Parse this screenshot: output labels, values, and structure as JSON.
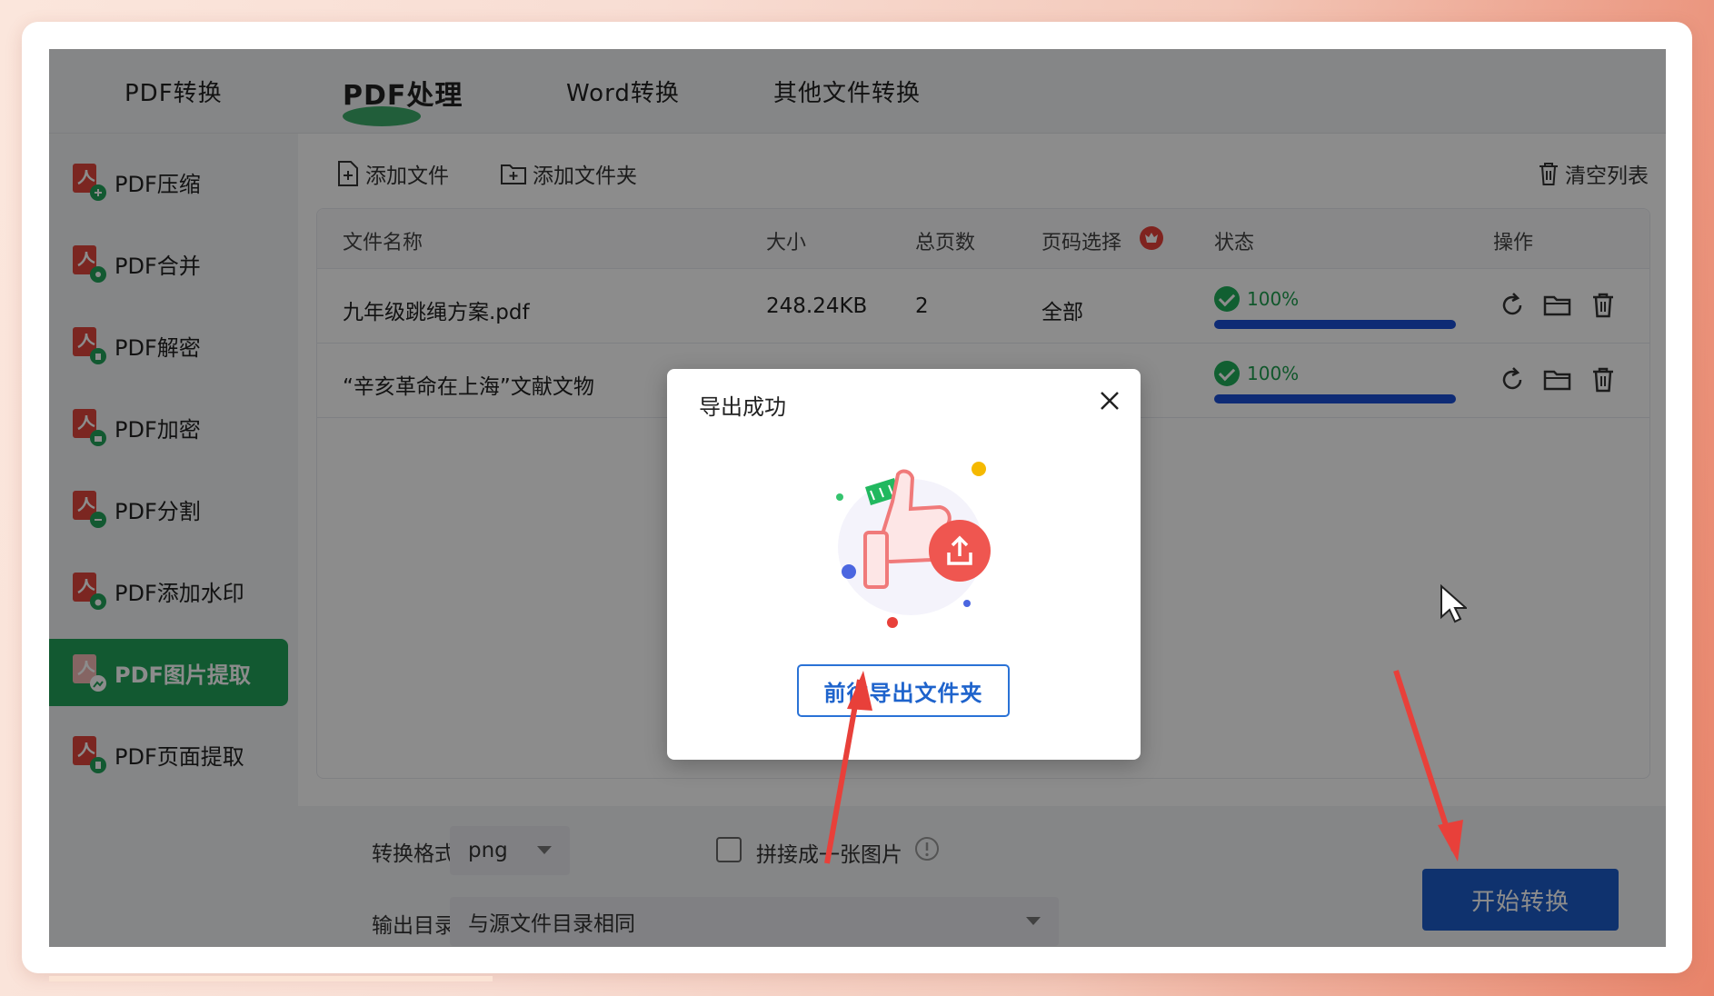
{
  "top_tabs": [
    {
      "label": "PDF转换",
      "active": false
    },
    {
      "label": "PDF处理",
      "active": true
    },
    {
      "label": "Word转换",
      "active": false
    },
    {
      "label": "其他文件转换",
      "active": false
    }
  ],
  "sidebar": {
    "items": [
      {
        "label": "PDF压缩",
        "active": false
      },
      {
        "label": "PDF合并",
        "active": false
      },
      {
        "label": "PDF解密",
        "active": false
      },
      {
        "label": "PDF加密",
        "active": false
      },
      {
        "label": "PDF分割",
        "active": false
      },
      {
        "label": "PDF添加水印",
        "active": false
      },
      {
        "label": "PDF图片提取",
        "active": true
      },
      {
        "label": "PDF页面提取",
        "active": false
      }
    ]
  },
  "toolbar": {
    "add_file": "添加文件",
    "add_folder": "添加文件夹",
    "clear_list": "清空列表"
  },
  "table": {
    "headers": {
      "name": "文件名称",
      "size": "大小",
      "pages": "总页数",
      "page_select": "页码选择",
      "status": "状态",
      "actions": "操作"
    },
    "rows": [
      {
        "name": "九年级跳绳方案.pdf",
        "size": "248.24KB",
        "pages": "2",
        "page_select": "全部",
        "progress": "100%"
      },
      {
        "name": "“辛亥革命在上海”文献文物",
        "size": "",
        "pages": "",
        "page_select": "",
        "progress": "100%"
      }
    ]
  },
  "bottom": {
    "format_label": "转换格式",
    "format_value": "png",
    "merge_label": "拼接成一张图片",
    "output_label": "输出目录",
    "output_value": "与源文件目录相同",
    "start_button": "开始转换"
  },
  "modal": {
    "title": "导出成功",
    "button": "前往导出文件夹"
  },
  "colors": {
    "accent_green": "#22a25a",
    "primary_blue": "#1c5cc9",
    "arrow_red": "#e8403a"
  }
}
